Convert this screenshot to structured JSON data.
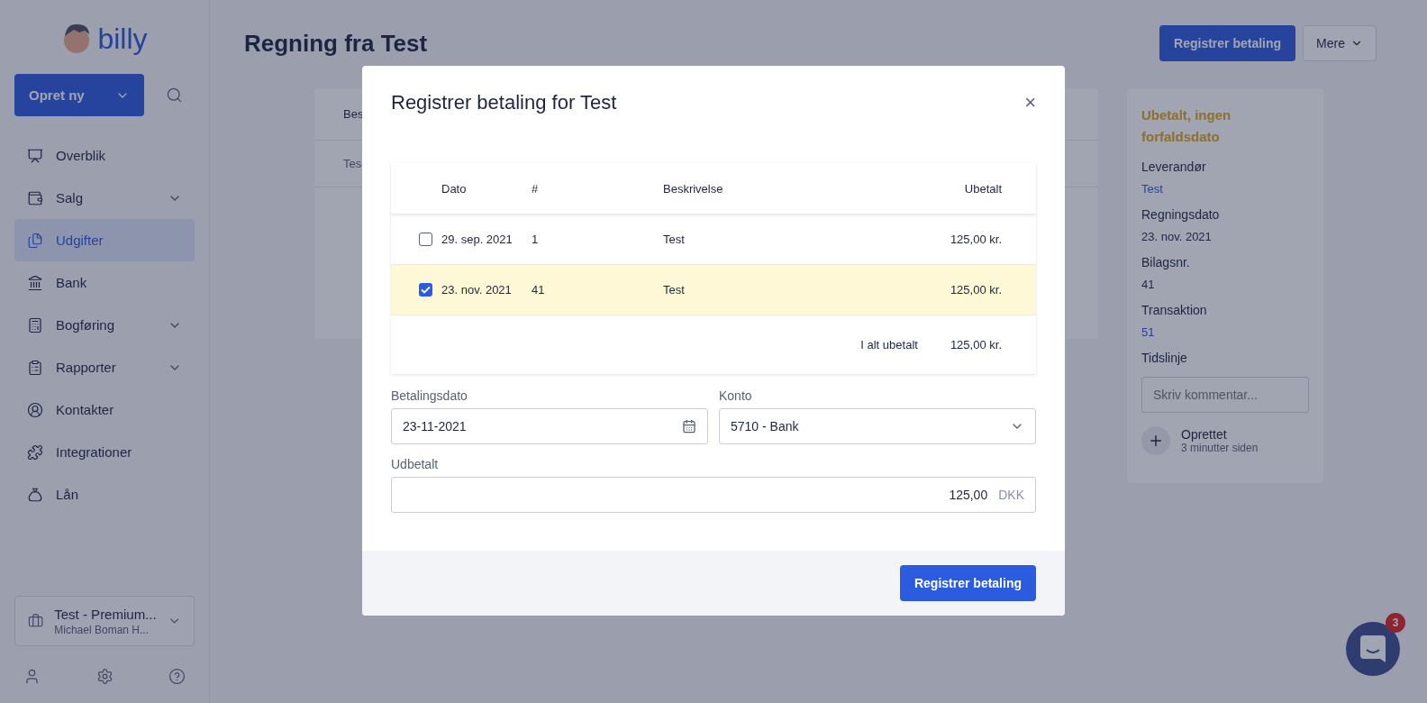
{
  "sidebar": {
    "logo": "billy",
    "create_button": "Opret ny",
    "items": [
      {
        "label": "Overblik",
        "selected": false,
        "expandable": false
      },
      {
        "label": "Salg",
        "selected": false,
        "expandable": true
      },
      {
        "label": "Udgifter",
        "selected": true,
        "expandable": false
      },
      {
        "label": "Bank",
        "selected": false,
        "expandable": false
      },
      {
        "label": "Bogføring",
        "selected": false,
        "expandable": true
      },
      {
        "label": "Rapporter",
        "selected": false,
        "expandable": true
      },
      {
        "label": "Kontakter",
        "selected": false,
        "expandable": false
      },
      {
        "label": "Integrationer",
        "selected": false,
        "expandable": false
      },
      {
        "label": "Lån",
        "selected": false,
        "expandable": false
      }
    ],
    "organization": {
      "name": "Test - Premium...",
      "user": "Michael Boman H..."
    }
  },
  "page": {
    "title": "Regning fra Test",
    "primary_button": "Registrer betaling",
    "more_button": "Mere",
    "table": {
      "header": "Bes",
      "row": "Tes"
    },
    "details": {
      "status": "Ubetalt, ingen forfaldsdato",
      "fields": [
        {
          "label": "Leverandør",
          "value": "Test",
          "link": true
        },
        {
          "label": "Regningsdato",
          "value": "23. nov. 2021",
          "link": false
        },
        {
          "label": "Bilagsnr.",
          "value": "41",
          "link": false
        },
        {
          "label": "Transaktion",
          "value": "51",
          "link": true
        }
      ],
      "timeline_title": "Tidslinje",
      "comment_placeholder": "Skriv kommentar...",
      "events": [
        {
          "title": "Oprettet",
          "time": "3 minutter siden"
        }
      ]
    }
  },
  "modal": {
    "title": "Registrer betaling for Test",
    "close": "×",
    "columns": [
      "Dato",
      "#",
      "Beskrivelse",
      "Ubetalt"
    ],
    "rows": [
      {
        "checked": false,
        "date": "29. sep. 2021",
        "number": "1",
        "description": "Test",
        "unpaid": "125,00 kr."
      },
      {
        "checked": true,
        "date": "23. nov. 2021",
        "number": "41",
        "description": "Test",
        "unpaid": "125,00 kr."
      }
    ],
    "total_label": "I alt ubetalt",
    "total": "125,00 kr.",
    "payment_date": {
      "label": "Betalingsdato",
      "value": "23-11-2021"
    },
    "account": {
      "label": "Konto",
      "value": "5710 - Bank"
    },
    "paid": {
      "label": "Udbetalt",
      "value": "125,00",
      "currency": "DKK"
    },
    "submit": "Registrer betaling"
  },
  "chat": {
    "badge": "3"
  }
}
